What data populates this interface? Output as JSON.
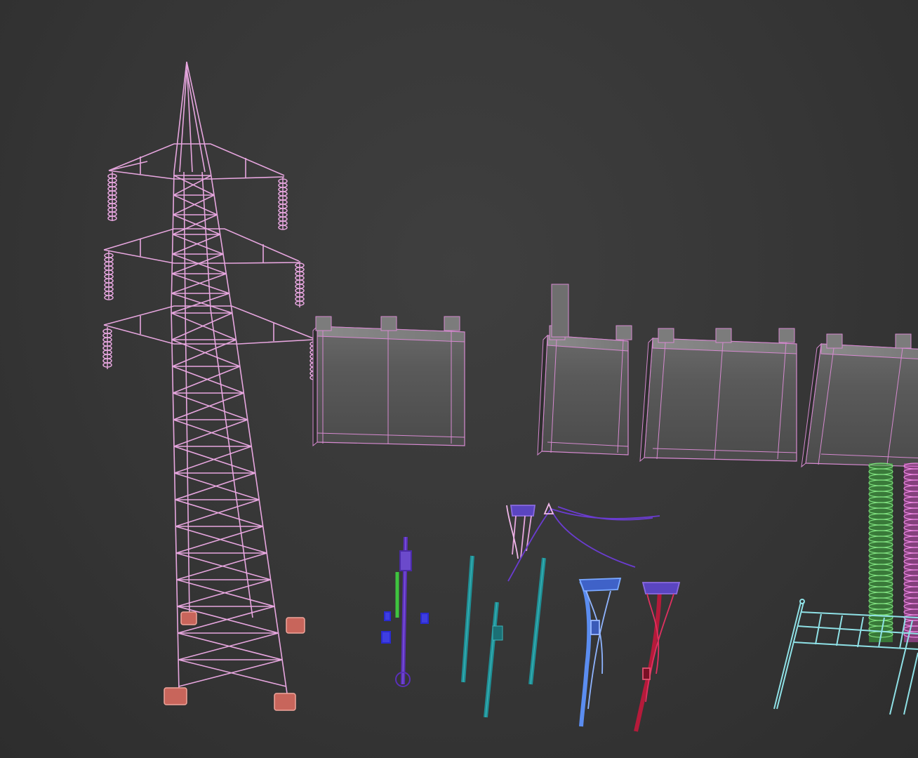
{
  "viewport": {
    "background": "#383838",
    "mode": "wireframe-on-shaded",
    "objects": [
      {
        "name": "transmission-tower",
        "wire_color": "#e7a6df"
      },
      {
        "name": "concrete-fence-panels",
        "wire_color": "#d68ad0"
      },
      {
        "name": "pole-set-purple",
        "wire_color": "#5a2fb8"
      },
      {
        "name": "pole-set-teal",
        "wire_color": "#1f8f95"
      },
      {
        "name": "pole-set-blue",
        "wire_color": "#5b8df0"
      },
      {
        "name": "pole-set-red",
        "wire_color": "#b51a3a"
      },
      {
        "name": "insulator-green",
        "wire_color": "#3fb43f"
      },
      {
        "name": "insulator-magenta",
        "wire_color": "#c84cb9"
      },
      {
        "name": "railing-frame",
        "wire_color": "#8fe1e6"
      }
    ]
  }
}
